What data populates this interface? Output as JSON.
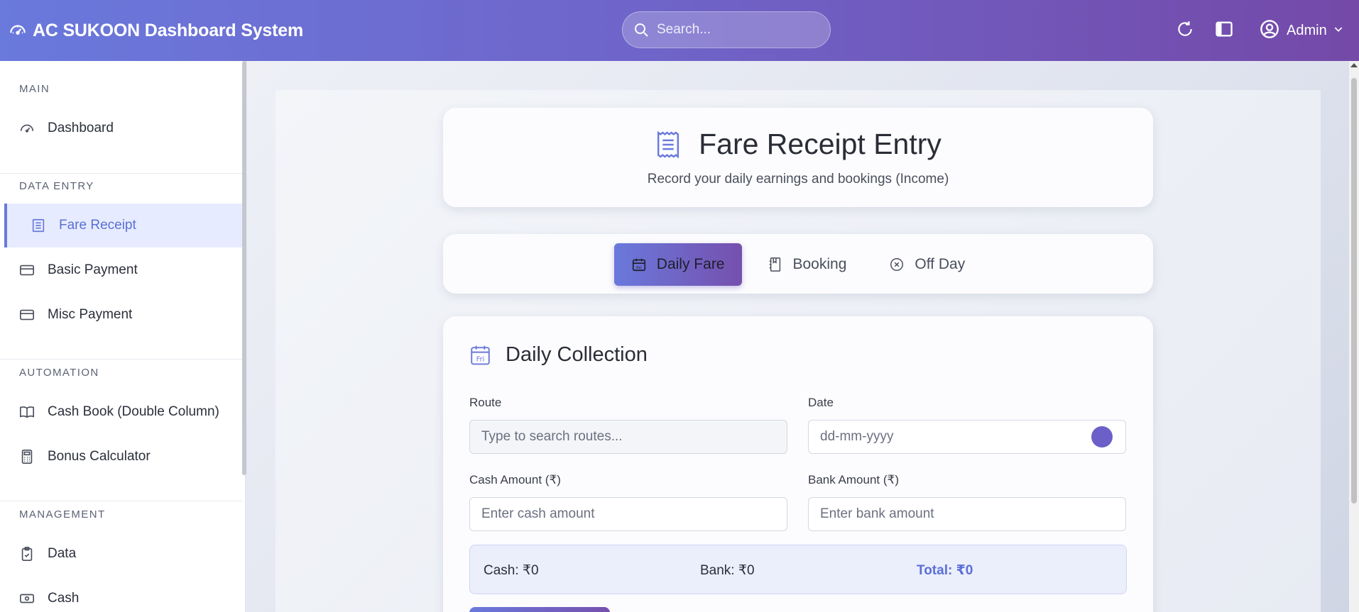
{
  "header": {
    "title": "AC SUKOON Dashboard System",
    "search_placeholder": "Search...",
    "user_label": "Admin"
  },
  "sidebar": {
    "sections": [
      {
        "title": "MAIN",
        "items": [
          {
            "label": "Dashboard",
            "icon": "dashboard-icon"
          }
        ]
      },
      {
        "title": "DATA ENTRY",
        "items": [
          {
            "label": "Fare Receipt",
            "icon": "receipt-icon",
            "active": true
          },
          {
            "label": "Basic Payment",
            "icon": "card-icon"
          },
          {
            "label": "Misc Payment",
            "icon": "card-icon"
          }
        ]
      },
      {
        "title": "AUTOMATION",
        "items": [
          {
            "label": "Cash Book (Double Column)",
            "icon": "book-icon"
          },
          {
            "label": "Bonus Calculator",
            "icon": "calculator-icon"
          }
        ]
      },
      {
        "title": "MANAGEMENT",
        "items": [
          {
            "label": "Data",
            "icon": "clipboard-icon"
          },
          {
            "label": "Cash",
            "icon": "cash-icon"
          }
        ]
      }
    ]
  },
  "page": {
    "title": "Fare Receipt Entry",
    "subtitle": "Record your daily earnings and bookings (Income)"
  },
  "tabs": [
    {
      "label": "Daily Fare",
      "icon_text": "Fri",
      "active": true
    },
    {
      "label": "Booking"
    },
    {
      "label": "Off Day"
    }
  ],
  "form": {
    "title": "Daily Collection",
    "icon_text": "Fri",
    "route_label": "Route",
    "route_placeholder": "Type to search routes...",
    "date_label": "Date",
    "date_placeholder": "dd-mm-yyyy",
    "cash_label": "Cash Amount (₹)",
    "cash_placeholder": "Enter cash amount",
    "bank_label": "Bank Amount (₹)",
    "bank_placeholder": "Enter bank amount"
  },
  "summary": {
    "cash": "Cash: ₹0",
    "bank": "Bank: ₹0",
    "total": "Total: ₹0"
  },
  "colors": {
    "accent": "#6a79dc",
    "accent_dark": "#7449a8",
    "active_bg": "#e6ebff"
  }
}
